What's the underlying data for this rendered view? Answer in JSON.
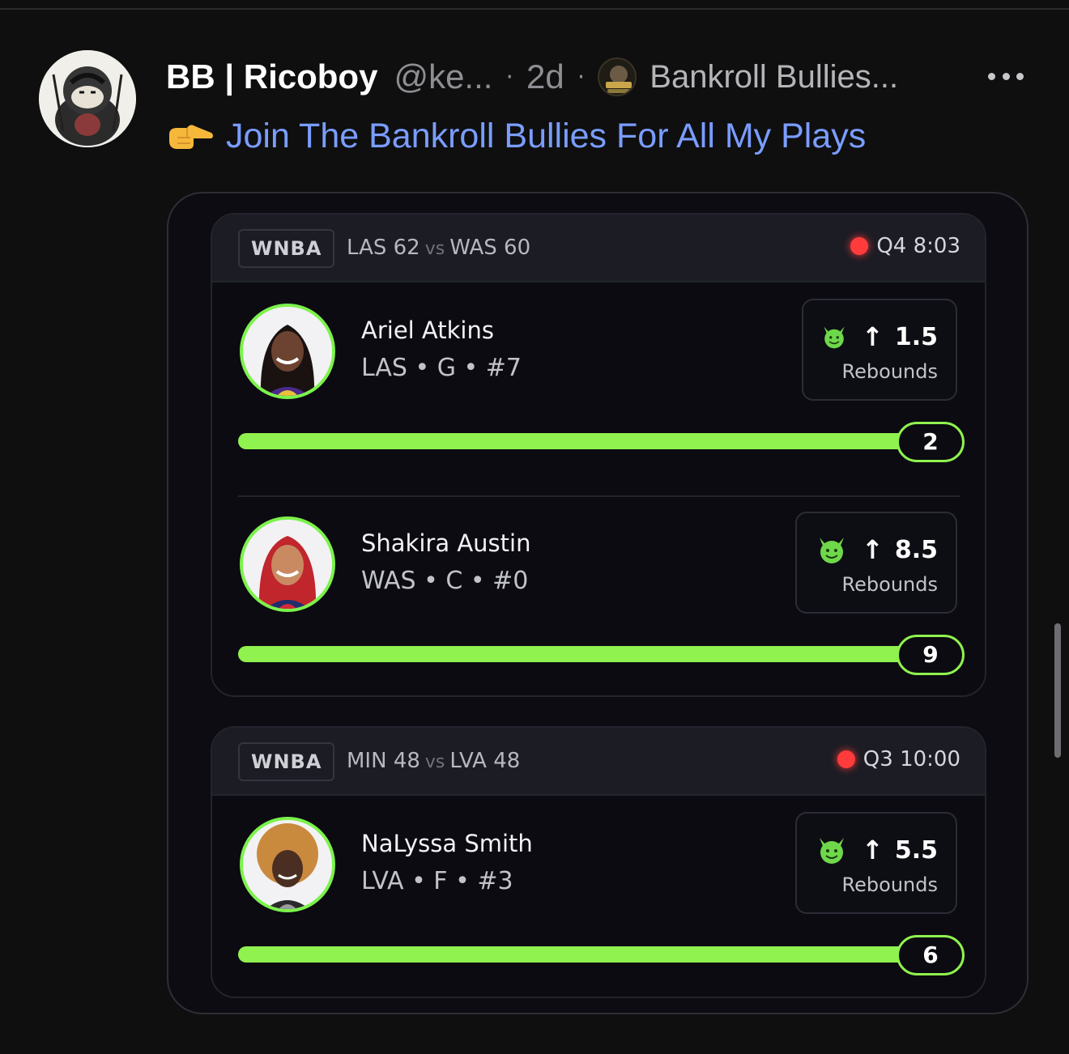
{
  "post": {
    "author": "BB | Ricoboy",
    "handle": "@ke...",
    "separator": "·",
    "time": "2d",
    "group": "Bankroll Bullies...",
    "text": "Join The Bankroll Bullies For All My Plays",
    "pointer_emoji": "backhand-index-pointing-right"
  },
  "games": [
    {
      "league": "WNBA",
      "home": "LAS 62",
      "vs": "vs",
      "away": "WAS 60",
      "status": "Q4 8:03",
      "players": [
        {
          "name": "Ariel Atkins",
          "meta": "LAS • G • #7",
          "line": "1.5",
          "stat": "Rebounds",
          "result": "2",
          "progress": 1.0
        },
        {
          "name": "Shakira Austin",
          "meta": "WAS • C • #0",
          "line": "8.5",
          "stat": "Rebounds",
          "result": "9",
          "progress": 1.0
        }
      ]
    },
    {
      "league": "WNBA",
      "home": "MIN 48",
      "vs": "vs",
      "away": "LVA 48",
      "status": "Q3 10:00",
      "players": [
        {
          "name": "NaLyssa Smith",
          "meta": "LVA • F • #3",
          "line": "5.5",
          "stat": "Rebounds",
          "result": "6",
          "progress": 1.0
        }
      ]
    }
  ],
  "colors": {
    "accent_green": "#8ff24e",
    "live_red": "#ff3b3b",
    "link_blue": "#7a9dff"
  }
}
